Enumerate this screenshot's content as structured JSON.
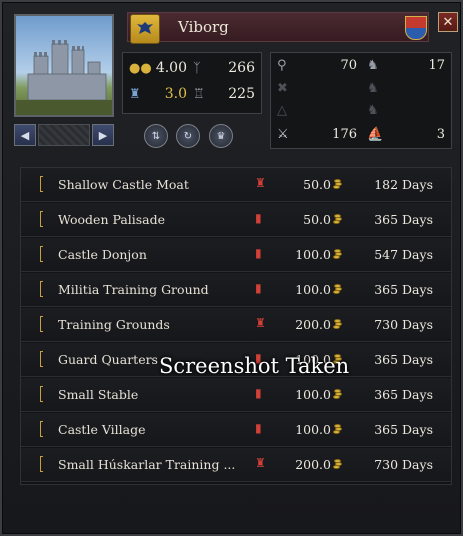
{
  "holding": {
    "name": "Viborg",
    "icons": {
      "emblem": "eagle-icon",
      "coat": "coat-of-arms-icon",
      "portrait": "castle-portrait"
    }
  },
  "stats": {
    "tax": "4.00",
    "garrison": "266",
    "build_bonus": "3.0",
    "levy": "225"
  },
  "levies": {
    "light_infantry": "70",
    "light_cavalry": "17",
    "heavy_infantry": "176",
    "galleys": "3"
  },
  "buildings": [
    {
      "name": "Shallow Castle Moat",
      "cost": "50.0",
      "days": "182 Days",
      "icon": "tower-icon"
    },
    {
      "name": "Wooden Palisade",
      "cost": "50.0",
      "days": "365 Days",
      "icon": "barrel-icon"
    },
    {
      "name": "Castle Donjon",
      "cost": "100.0",
      "days": "547 Days",
      "icon": "barrel-icon"
    },
    {
      "name": "Militia Training Ground",
      "cost": "100.0",
      "days": "365 Days",
      "icon": "barrel-icon"
    },
    {
      "name": "Training Grounds",
      "cost": "200.0",
      "days": "730 Days",
      "icon": "tower-icon"
    },
    {
      "name": "Guard Quarters",
      "cost": "100.0",
      "days": "365 Days",
      "icon": "barrel-icon"
    },
    {
      "name": "Small Stable",
      "cost": "100.0",
      "days": "365 Days",
      "icon": "barrel-icon"
    },
    {
      "name": "Castle Village",
      "cost": "100.0",
      "days": "365 Days",
      "icon": "barrel-icon"
    },
    {
      "name": "Small Húskarlar Training ...",
      "cost": "200.0",
      "days": "730 Days",
      "icon": "tower-icon"
    }
  ],
  "overlay": {
    "text": "Screenshot Taken"
  },
  "colors": {
    "accent": "#c9a03c",
    "banner": "#4a2a30",
    "requirement": "#d24038"
  }
}
